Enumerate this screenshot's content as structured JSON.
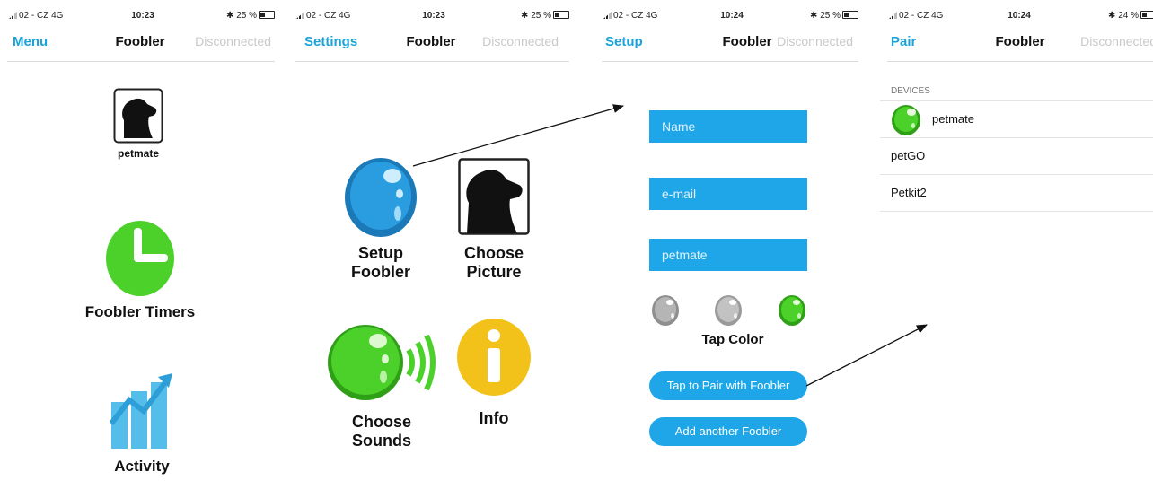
{
  "screens": [
    {
      "status": {
        "carrier": "02 - CZ  4G",
        "time": "10:23",
        "battery": "25 %"
      },
      "nav": {
        "left": "Menu",
        "title": "Foobler",
        "right": "Disconnected"
      },
      "items": {
        "pet_label": "petmate",
        "timers_label": "Foobler Timers",
        "activity_label": "Activity"
      }
    },
    {
      "status": {
        "carrier": "02 - CZ  4G",
        "time": "10:23",
        "battery": "25 %"
      },
      "nav": {
        "left": "Settings",
        "title": "Foobler",
        "right": "Disconnected"
      },
      "items": {
        "setup_line1": "Setup",
        "setup_line2": "Foobler",
        "picture_line1": "Choose",
        "picture_line2": "Picture",
        "sounds_line1": "Choose",
        "sounds_line2": "Sounds",
        "info_label": "Info"
      }
    },
    {
      "status": {
        "carrier": "02 - CZ  4G",
        "time": "10:24",
        "battery": "25 %"
      },
      "nav": {
        "left": "Setup",
        "title": "Foobler",
        "right": "Disconnected"
      },
      "form": {
        "name_placeholder": "Name",
        "email_placeholder": "e-mail",
        "pet_value": "petmate",
        "tap_color_label": "Tap Color",
        "pair_button": "Tap to Pair with Foobler",
        "add_button": "Add another Foobler"
      }
    },
    {
      "status": {
        "carrier": "02 - CZ  4G",
        "time": "10:24",
        "battery": "24 %"
      },
      "nav": {
        "left": "Pair",
        "title": "Foobler",
        "right": "Disconnected"
      },
      "devices_header": "DEVICES",
      "devices": [
        {
          "name": "petmate"
        },
        {
          "name": "petGO"
        },
        {
          "name": "Petkit2"
        }
      ]
    }
  ],
  "colors": {
    "accent": "#1aa3d8",
    "field": "#1ea6e8",
    "green": "#4cd12a",
    "yellow": "#f2c21b",
    "gray": "#9a9a9a"
  }
}
